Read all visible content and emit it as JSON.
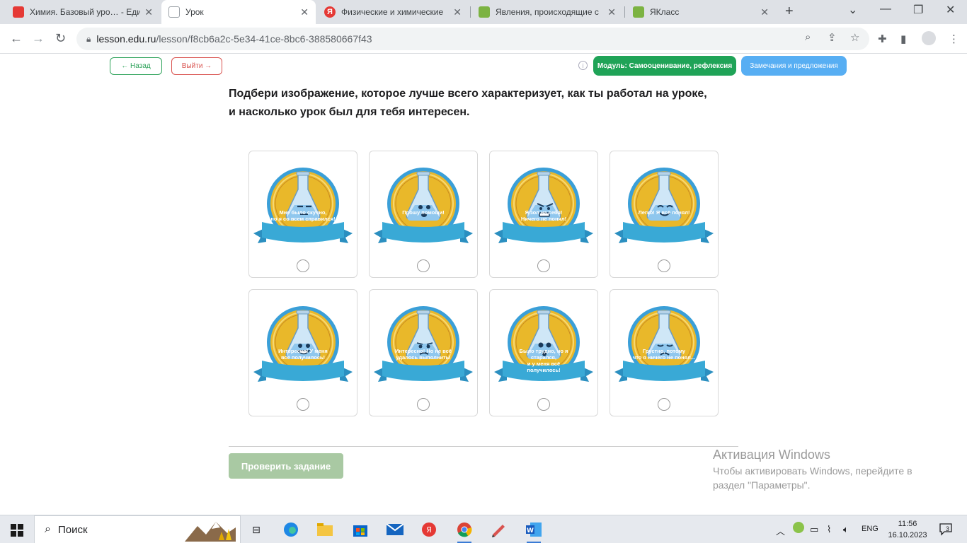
{
  "browser": {
    "tabs": [
      {
        "title": "Химия. Базовый уро… - Еди",
        "favicon_color": "#e53935"
      },
      {
        "title": "Урок",
        "favicon_color": "#9aa0a6",
        "active": true
      },
      {
        "title": "Физические и химические",
        "favicon_color": "#e53935",
        "favicon_glyph": "Я"
      },
      {
        "title": "Явления, происходящие с",
        "favicon_color": "#7cb342"
      },
      {
        "title": "ЯКласс",
        "favicon_color": "#7cb342"
      }
    ],
    "address": {
      "host": "lesson.edu.ru",
      "path": "/lesson/f8cb6a2c-5e34-41ce-8bc6-388580667f43"
    }
  },
  "header": {
    "back_label": "← Назад",
    "exit_label": "Выйти →",
    "module_label": "Модуль: Самооценивание, рефлексия",
    "feedback_label": "Замечания и предложения",
    "info_glyph": "i"
  },
  "question": {
    "line1": "Подбери изображение, которое лучше всего характеризует, как ты работал на уроке,",
    "line2": "и насколько урок был для тебя интересен."
  },
  "cards": [
    {
      "line1": "Мне было скучно,",
      "line2": "но я со всем справился!",
      "mood": "bored"
    },
    {
      "line1": "Прошу помощи!",
      "line2": "",
      "mood": "help"
    },
    {
      "line1": "Я зол на себя!",
      "line2": "Ничего не понял!",
      "mood": "angry"
    },
    {
      "line1": "Легко! Я всё понял!",
      "line2": "",
      "mood": "easy"
    },
    {
      "line1": "Интересно! У меня",
      "line2": "всё получилось!",
      "mood": "happy"
    },
    {
      "line1": "Интересно! Но не всё",
      "line2": "удалось выполнить!",
      "mood": "worried"
    },
    {
      "line1": "Было трудно, но я старался,",
      "line2": "и у меня всё получилось!",
      "mood": "surprised"
    },
    {
      "line1": "Грустно, потому",
      "line2": "что я ничего не понял...",
      "mood": "sad"
    }
  ],
  "actions": {
    "check_label": "Проверить задание"
  },
  "watermark": {
    "title": "Активация Windows",
    "line1": "Чтобы активировать Windows, перейдите в",
    "line2": "раздел \"Параметры\"."
  },
  "taskbar": {
    "search_placeholder": "Поиск",
    "language": "ENG",
    "time": "11:56",
    "date": "16.10.2023",
    "notification_count": "3"
  },
  "colors": {
    "medal_gold": "#e9b82a",
    "medal_rim": "#3a9fd8",
    "ribbon": "#39a9d6",
    "green": "#1fa357",
    "blue": "#57aef3"
  }
}
